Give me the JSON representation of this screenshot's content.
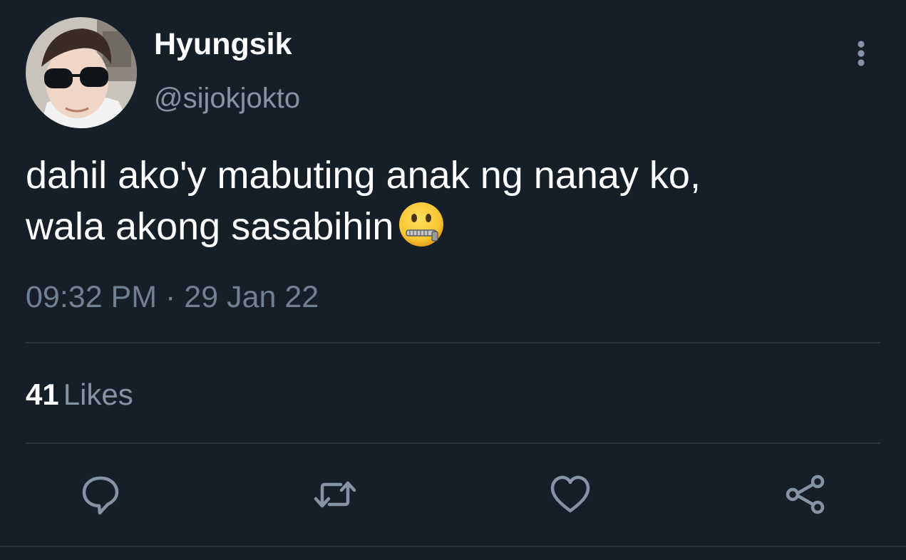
{
  "tweet": {
    "display_name": "Hyungsik",
    "handle": "@sijokjokto",
    "text_line1": "dahil ako'y mabuting anak ng nanay ko,",
    "text_line2": "wala akong sasabihin",
    "emoji": "zipper-mouth-face",
    "time": "09:32 PM",
    "separator": "·",
    "date": "29 Jan 22",
    "likes_count": "41",
    "likes_label": "Likes"
  },
  "actions": {
    "reply_icon": "speech-bubble-icon",
    "retweet_icon": "retweet-icon",
    "like_icon": "heart-icon",
    "share_icon": "share-icon",
    "more_icon": "vertical-ellipsis-icon"
  },
  "colors": {
    "background": "#161e28",
    "primary_text": "#ffffff",
    "secondary_text": "#8494a6",
    "icon": "#8494a6",
    "divider": "#2b3642"
  }
}
